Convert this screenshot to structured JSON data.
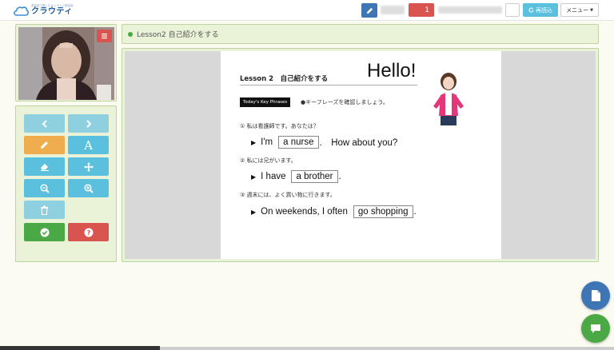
{
  "header": {
    "logo_tagline": "英会話で楽しむオンライン英会話",
    "logo_name": "クラウティ",
    "badge_count": "1",
    "reload_label": "再読込",
    "menu_label": "メニュー"
  },
  "lesson": {
    "title": "Lesson2 自己紹介をする"
  },
  "slide": {
    "lesson_heading": "Lesson 2　自己紹介をする",
    "hello": "Hello!",
    "key_label": "Today's Key Phrases",
    "key_instruction": "●キーフレーズを確認しましょう。",
    "items": [
      {
        "jp": "① 私は看護師です。あなたは？",
        "en_pre": "I'm",
        "en_box": "a nurse",
        "en_post": ".　How about you?"
      },
      {
        "jp": "② 私には兄がいます。",
        "en_pre": "I have",
        "en_box": "a brother",
        "en_post": "."
      },
      {
        "jp": "③ 週末には、よく買い物に行きます。",
        "en_pre": "On weekends, I often",
        "en_box": "go shopping",
        "en_post": "."
      }
    ]
  },
  "colors": {
    "panel_bg": "#eaf3d8",
    "accent_blue": "#5bc0de",
    "accent_red": "#d9534f",
    "accent_green": "#4aa845",
    "accent_orange": "#f0ad4e"
  }
}
